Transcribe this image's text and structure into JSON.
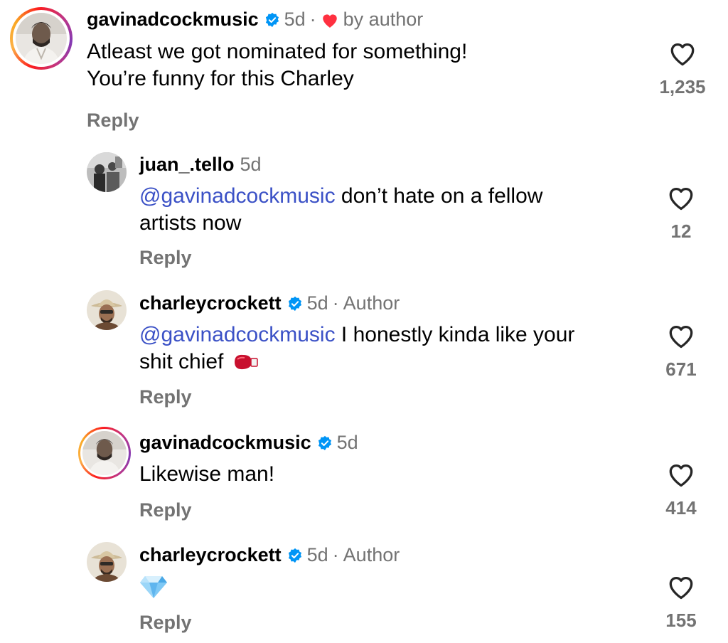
{
  "comments": [
    {
      "username": "gavinadcockmusic",
      "verified": true,
      "time": "5d",
      "liked_by_author_label": "by author",
      "lines": [
        "Atleast we got nominated for something!",
        "You’re funny for this Charley"
      ],
      "reply_label": "Reply",
      "like_count": "1,235",
      "avatar": "gavin-avatar"
    },
    {
      "username": "juan_.tello",
      "verified": false,
      "time": "5d",
      "mention": "@gavinadcockmusic",
      "line1_rest": " don’t hate on a fellow",
      "line2": "artists now",
      "reply_label": "Reply",
      "like_count": "12",
      "avatar": "juan-avatar"
    },
    {
      "username": "charleycrockett",
      "verified": true,
      "time": "5d",
      "author_label": "Author",
      "mention": "@gavinadcockmusic",
      "line1_rest": " I honestly kinda like your",
      "line2": "shit chief",
      "emoji": "boxing-glove-icon",
      "reply_label": "Reply",
      "like_count": "671",
      "avatar": "charley-avatar"
    },
    {
      "username": "gavinadcockmusic",
      "verified": true,
      "time": "5d",
      "lines": [
        "Likewise man!"
      ],
      "reply_label": "Reply",
      "like_count": "414",
      "avatar": "gavin-avatar"
    },
    {
      "username": "charleycrockett",
      "verified": true,
      "time": "5d",
      "author_label": "Author",
      "emoji": "gem-icon",
      "reply_label": "Reply",
      "like_count": "155",
      "avatar": "charley-avatar"
    }
  ],
  "colors": {
    "mention": "#3b51c6",
    "verified": "#0095f6",
    "heart_red": "#ff3040",
    "muted": "#737373"
  }
}
